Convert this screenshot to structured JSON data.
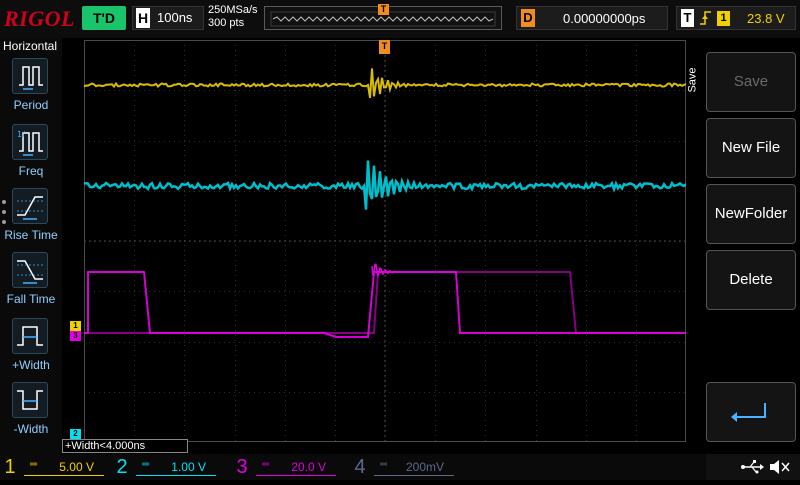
{
  "topbar": {
    "logo": "RIGOL",
    "run_state": "T'D",
    "horizontal": {
      "label": "H",
      "timebase": "100ns"
    },
    "sample_rate": "250MSa/s",
    "memory_depth": "300 pts",
    "trigger_marker": "T",
    "delay": {
      "label": "D",
      "value": "0.00000000ps"
    },
    "trigger": {
      "label": "T",
      "edge_icon": "rising-edge-icon",
      "source": "1",
      "level": "23.8 V"
    }
  },
  "left_menu": {
    "title": "Horizontal",
    "items": [
      {
        "label": "Period",
        "icon": "period-icon"
      },
      {
        "label": "Freq",
        "icon": "frequency-icon"
      },
      {
        "label": "Rise Time",
        "icon": "rise-time-icon"
      },
      {
        "label": "Fall Time",
        "icon": "fall-time-icon"
      },
      {
        "label": "+Width",
        "icon": "positive-width-icon"
      },
      {
        "label": "-Width",
        "icon": "negative-width-icon"
      }
    ]
  },
  "channel_markers": {
    "ch1": "1",
    "ch2": "2",
    "ch3": "3"
  },
  "measurement": {
    "label": "+Width<4.000ns"
  },
  "right_menu": {
    "side_label": "Save",
    "buttons": [
      {
        "label": "Save",
        "enabled": false
      },
      {
        "label": "New File",
        "enabled": true
      },
      {
        "label": "NewFolder",
        "enabled": true
      },
      {
        "label": "Delete",
        "enabled": true
      },
      {
        "label": "",
        "icon": "enter-return-icon",
        "enabled": true
      }
    ]
  },
  "channels": [
    {
      "num": "1",
      "scale": "5.00 V",
      "color": "#f0d000",
      "active": true
    },
    {
      "num": "2",
      "scale": "1.00 V",
      "color": "#00e0f0",
      "active": true
    },
    {
      "num": "3",
      "scale": "20.0 V",
      "color": "#e000e0",
      "active": true
    },
    {
      "num": "4",
      "scale": "200mV",
      "color": "#5a6a8a",
      "active": false
    }
  ],
  "status_icons": [
    "usb-icon",
    "speaker-muted-icon"
  ],
  "colors": {
    "ch1": "#f0d000",
    "ch2": "#00e0f0",
    "ch3": "#e000e0",
    "trigger": "#f28c1e",
    "accent": "#19c46a"
  }
}
